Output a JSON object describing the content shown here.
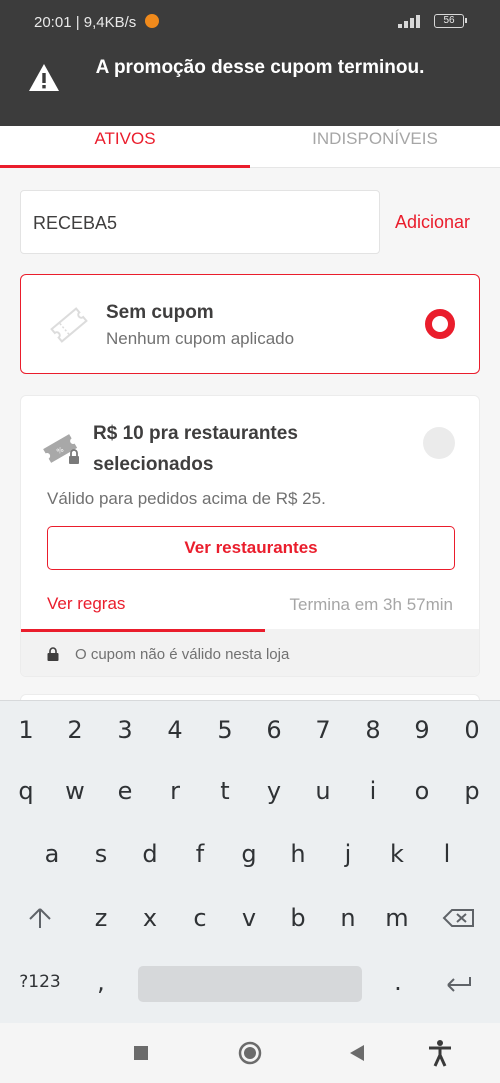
{
  "status_bar": {
    "time": "20:01 | 9,4KB/s",
    "battery": "56"
  },
  "toast": {
    "icon": "warning-icon",
    "message": "A promoção desse cupom terminou."
  },
  "tabs": [
    {
      "label": "ATIVOS",
      "active": true
    },
    {
      "label": "INDISPONÍVEIS",
      "active": false
    }
  ],
  "coupon_input": {
    "value": "RECEBA5",
    "add_label": "Adicionar"
  },
  "no_coupon_card": {
    "title": "Sem cupom",
    "subtitle": "Nenhum cupom aplicado",
    "selected": true
  },
  "promo_card": {
    "title": "R$ 10 pra restaurantes selecionados",
    "description": "Válido para pedidos acima de R$ 25.",
    "button_label": "Ver restaurantes",
    "rules_label": "Ver regras",
    "expires_text": "Termina em 3h 57min",
    "time_progress": 0.53,
    "invalid_text": "O cupom não é válido nesta loja",
    "selected": false
  },
  "keyboard": {
    "row_numbers": [
      "1",
      "2",
      "3",
      "4",
      "5",
      "6",
      "7",
      "8",
      "9",
      "0"
    ],
    "row_1": [
      "q",
      "w",
      "e",
      "r",
      "t",
      "y",
      "u",
      "i",
      "o",
      "p"
    ],
    "row_2": [
      "a",
      "s",
      "d",
      "f",
      "g",
      "h",
      "j",
      "k",
      "l"
    ],
    "row_3": [
      "z",
      "x",
      "c",
      "v",
      "b",
      "n",
      "m"
    ],
    "symbols_label": "?123",
    "comma": ",",
    "period": "."
  },
  "colors": {
    "accent": "#ea1d2c",
    "toast_bg": "#3c3c3c",
    "text_dark": "#3f3e3e",
    "text_muted": "#717171"
  }
}
